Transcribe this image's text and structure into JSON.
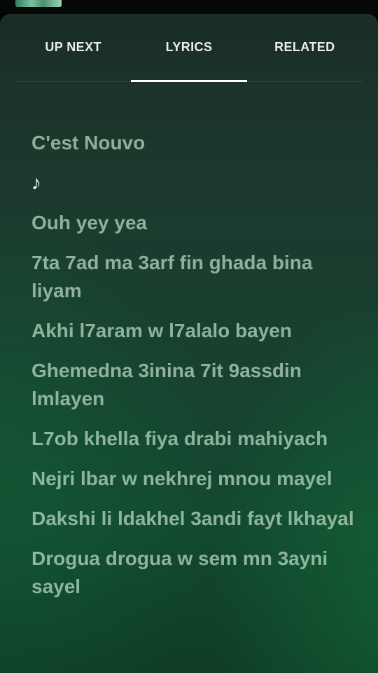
{
  "tabs": [
    {
      "label": "UP NEXT"
    },
    {
      "label": "LYRICS"
    },
    {
      "label": "RELATED"
    }
  ],
  "active_tab": "LYRICS",
  "lyrics": {
    "title": "C'est Nouvo",
    "note": "♪",
    "lines": [
      "Ouh yey yea",
      "7ta 7ad ma 3arf fin ghada bina liyam",
      "Akhi l7aram w l7alalo bayen",
      "Ghemedna 3inina 7it 9assdin lmlayen",
      "L7ob khella fiya drabi mahiyach",
      "Nejri lbar w nekhrej mnou mayel",
      "Dakshi li ldakhel 3andi fayt lkhayal",
      "Drogua drogua w sem mn 3ayni sayel"
    ]
  }
}
